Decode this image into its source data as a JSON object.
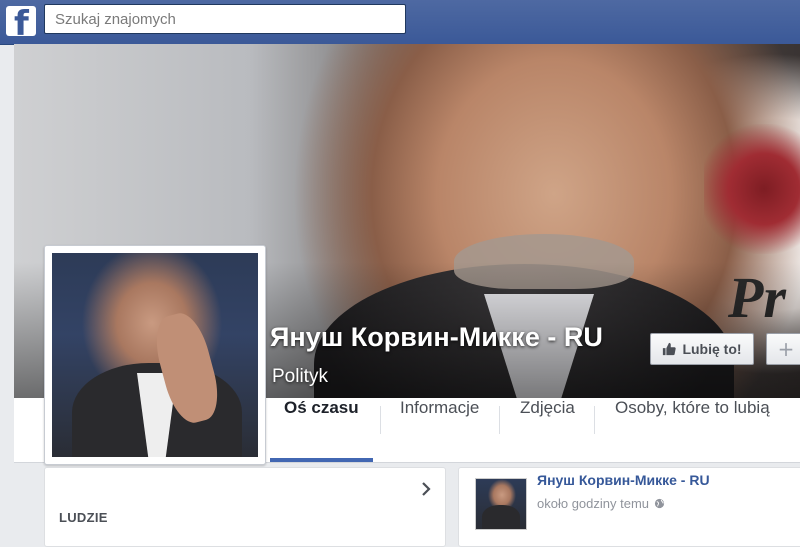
{
  "header": {
    "logo_letter": "f",
    "search_placeholder": "Szukaj znajomych"
  },
  "cover": {
    "overlay_text": "Pr"
  },
  "page": {
    "name": "Януш Корвин-Микке - RU",
    "category": "Polityk"
  },
  "actions": {
    "like_label": "Lubię to!",
    "more_label": "+"
  },
  "tabs": [
    {
      "label": "Oś czasu",
      "active": true
    },
    {
      "label": "Informacje",
      "active": false
    },
    {
      "label": "Zdjęcia",
      "active": false
    },
    {
      "label": "Osoby, które to lubią",
      "active": false
    }
  ],
  "sidebar": {
    "section_title": "LUDZIE"
  },
  "post": {
    "author": "Януш Корвин-Микке - RU",
    "time": "około godziny temu"
  },
  "colors": {
    "brand": "#3b5998",
    "link": "#365899",
    "tab_active": "#4267b2"
  },
  "icons": {
    "like": "thumbs-up-icon",
    "chevron": "chevron-right-icon",
    "privacy": "globe-icon"
  }
}
